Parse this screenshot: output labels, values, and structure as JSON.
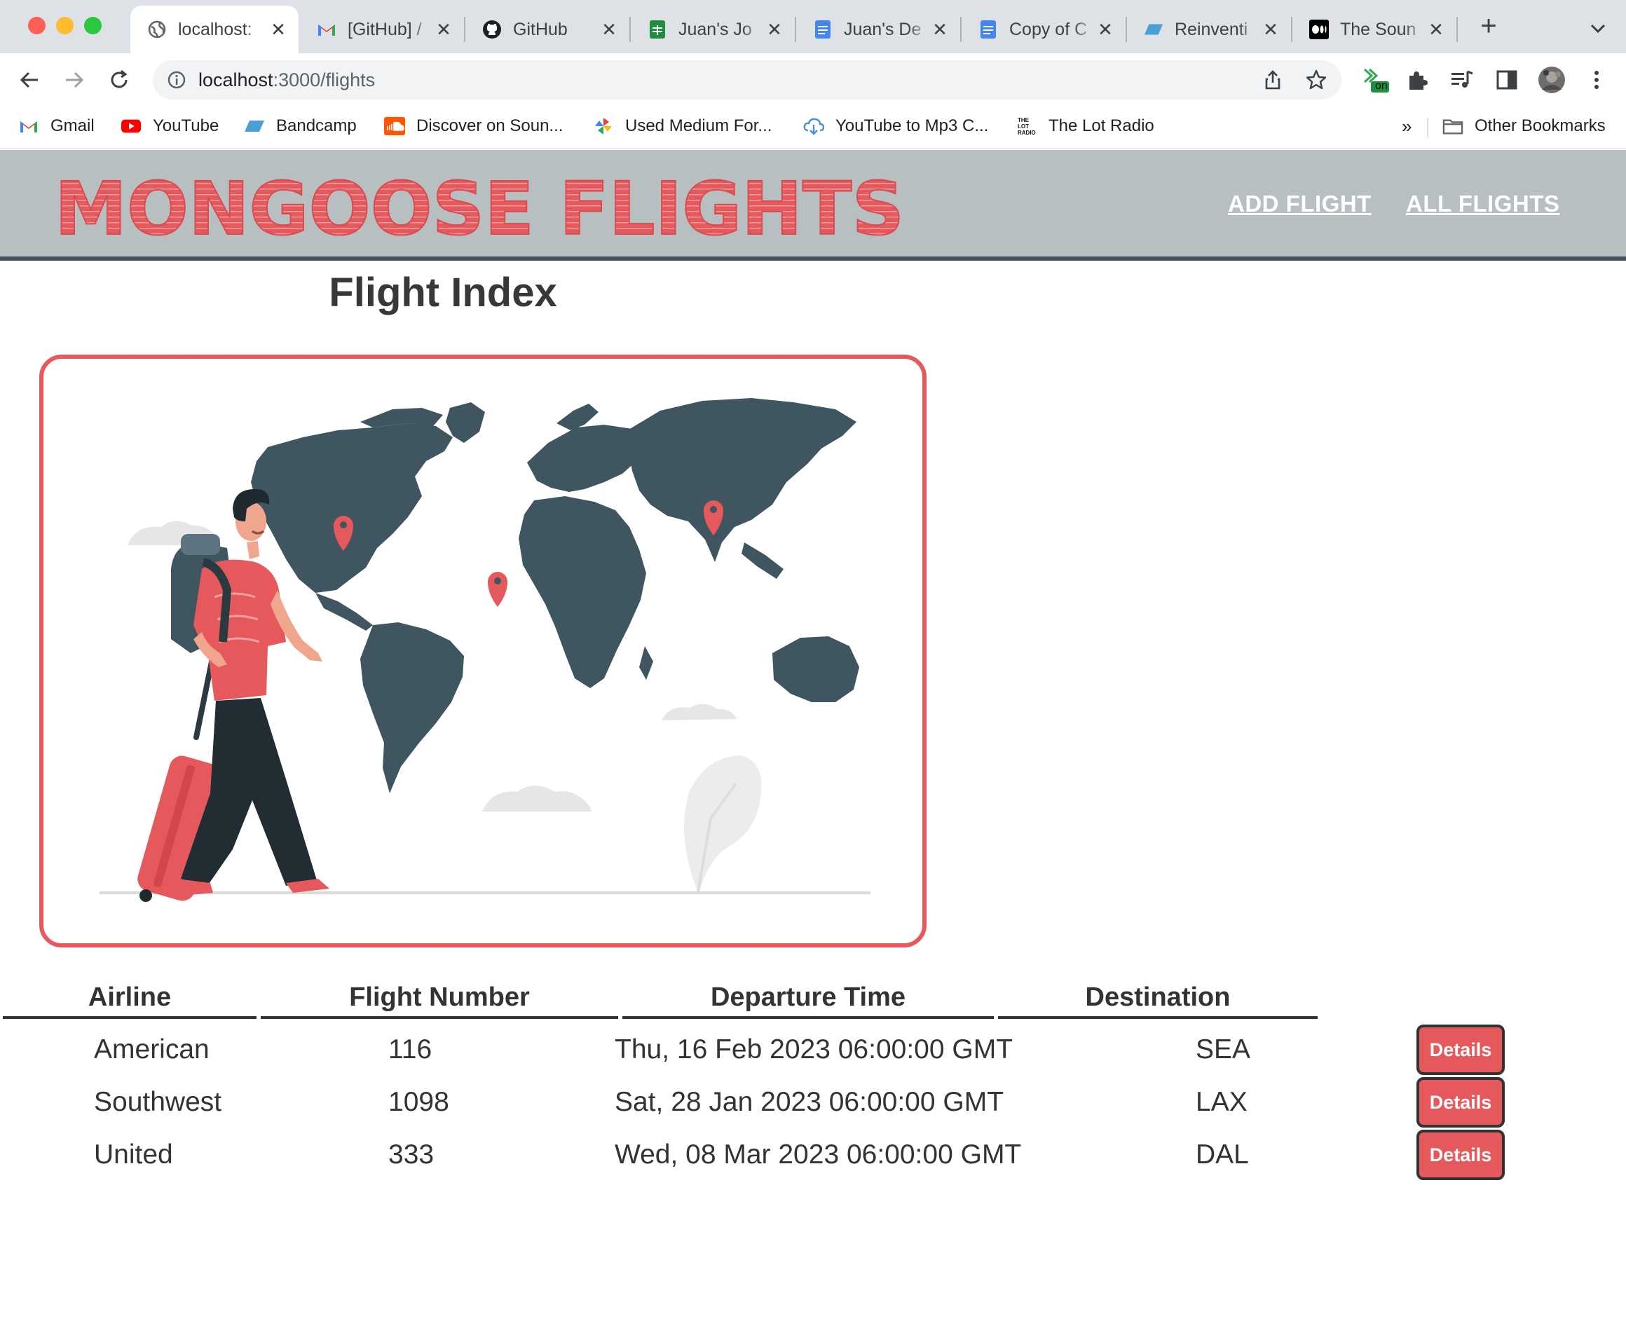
{
  "window": {
    "traffic_lights": [
      "#fe5f57",
      "#febc2e",
      "#28c840"
    ]
  },
  "tabs": [
    {
      "title": "localhost:",
      "icon": "globe-icon",
      "active": true
    },
    {
      "title": "[GitHub] /",
      "icon": "gmail-icon",
      "active": false
    },
    {
      "title": "GitHub",
      "icon": "github-icon",
      "active": false
    },
    {
      "title": "Juan's Jo",
      "icon": "sheets-icon",
      "active": false
    },
    {
      "title": "Juan's De",
      "icon": "docs-icon",
      "active": false
    },
    {
      "title": "Copy of C",
      "icon": "docs-icon",
      "active": false
    },
    {
      "title": "Reinventi",
      "icon": "parallelogram-icon",
      "active": false
    },
    {
      "title": "The Soun",
      "icon": "medium-icon",
      "active": false
    }
  ],
  "address_bar": {
    "host": "localhost",
    "path": ":3000/flights"
  },
  "extension_badge": "on",
  "bookmarks": [
    {
      "label": "Gmail",
      "icon": "gmail-icon"
    },
    {
      "label": "YouTube",
      "icon": "youtube-icon"
    },
    {
      "label": "Bandcamp",
      "icon": "bandcamp-icon"
    },
    {
      "label": "Discover on Soun...",
      "icon": "soundcloud-icon"
    },
    {
      "label": "Used Medium For...",
      "icon": "pinwheel-icon"
    },
    {
      "label": "YouTube to Mp3 C...",
      "icon": "cloud-download-icon"
    },
    {
      "label": "The Lot Radio",
      "icon": "lot-radio-icon"
    }
  ],
  "bookmarks_overflow": "»",
  "other_bookmarks": "Other Bookmarks",
  "site": {
    "logo": "MONGOOSE FLIGHTS",
    "nav": [
      {
        "label": "ADD FLIGHT"
      },
      {
        "label": "ALL FLIGHTS"
      }
    ],
    "page_title": "Flight Index",
    "accent": "#e5595d",
    "header_bg": "#b7bfc1",
    "map_color": "#3f5560"
  },
  "table": {
    "headers": [
      "Airline",
      "Flight Number",
      "Departure Time",
      "Destination"
    ],
    "rows": [
      {
        "airline": "American",
        "flight_number": "116",
        "departure": "Thu, 16 Feb 2023 06:00:00 GMT",
        "destination": "SEA",
        "action": "Details"
      },
      {
        "airline": "Southwest",
        "flight_number": "1098",
        "departure": "Sat, 28 Jan 2023 06:00:00 GMT",
        "destination": "LAX",
        "action": "Details"
      },
      {
        "airline": "United",
        "flight_number": "333",
        "departure": "Wed, 08 Mar 2023 06:00:00 GMT",
        "destination": "DAL",
        "action": "Details"
      }
    ]
  }
}
